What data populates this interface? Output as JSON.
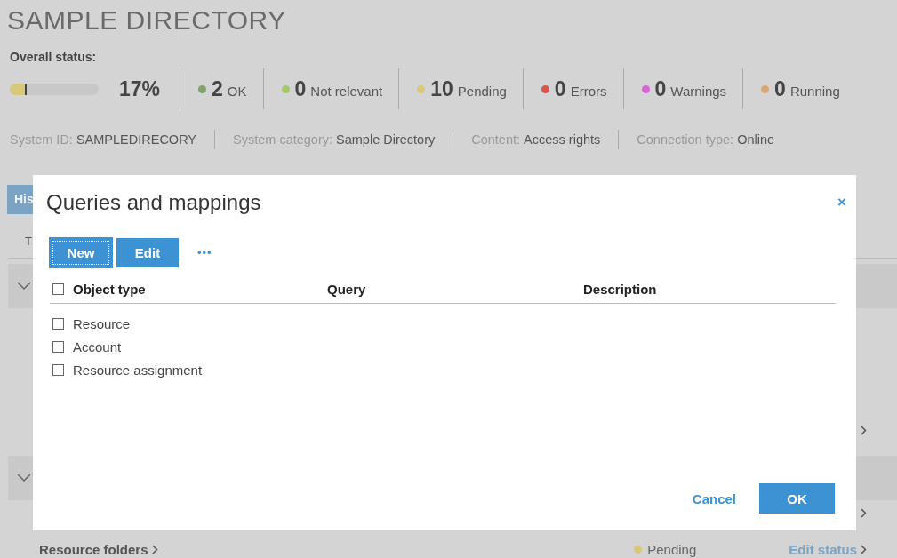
{
  "header": {
    "title": "SAMPLE DIRECTORY",
    "overall_label": "Overall status:"
  },
  "progress": {
    "level": 0.17,
    "percent": "17%"
  },
  "stats": [
    {
      "count": "2",
      "label": "OK",
      "color": "#7fa36b"
    },
    {
      "count": "0",
      "label": "Not relevant",
      "color": "#a6c76c"
    },
    {
      "count": "10",
      "label": "Pending",
      "color": "#d8c878"
    },
    {
      "count": "0",
      "label": "Errors",
      "color": "#d9534f"
    },
    {
      "count": "0",
      "label": "Warnings",
      "color": "#d665d6"
    },
    {
      "count": "0",
      "label": "Running",
      "color": "#d9a878"
    }
  ],
  "system_info": [
    {
      "key": "System ID:",
      "value": "SAMPLEDIRECORY"
    },
    {
      "key": "System category:",
      "value": "Sample Directory"
    },
    {
      "key": "Content:",
      "value": "Access rights"
    },
    {
      "key": "Connection type:",
      "value": "Online"
    }
  ],
  "background": {
    "tab": "His",
    "column_1": "T",
    "sections": [
      {
        "kind": "group"
      },
      {
        "kind": "link"
      },
      {
        "kind": "group"
      },
      {
        "kind": "link"
      },
      {
        "kind": "item",
        "name": "Resource folders",
        "status": "Pending",
        "color": "#d8c878",
        "action": "Edit status"
      }
    ]
  },
  "dialog": {
    "title": "Queries and mappings",
    "close": "×",
    "toolbar": [
      {
        "label": "New",
        "focused": true
      },
      {
        "label": "Edit",
        "focused": false
      }
    ],
    "more": "•••",
    "columns": [
      "Object type",
      "Query",
      "Description"
    ],
    "header_checked": false,
    "rows": [
      {
        "object_type": "Resource",
        "checked": false
      },
      {
        "object_type": "Account",
        "checked": false
      },
      {
        "object_type": "Resource assignment",
        "checked": false
      }
    ],
    "buttons": [
      {
        "label": "Cancel",
        "kind": "link"
      },
      {
        "label": "OK",
        "kind": "primary"
      }
    ]
  }
}
